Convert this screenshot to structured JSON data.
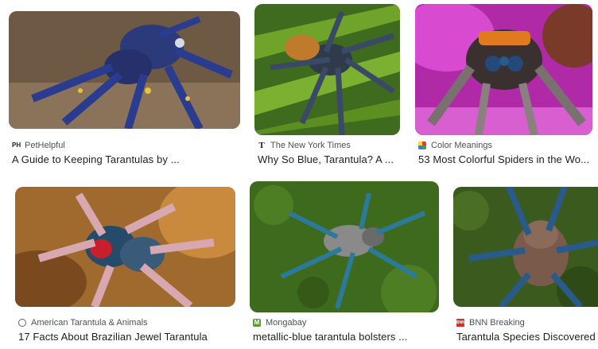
{
  "results": [
    {
      "source": "PetHelpful",
      "favicon": "PH",
      "title": "A Guide to Keeping Tarantulas by ..."
    },
    {
      "source": "The New York Times",
      "favicon": "T",
      "title": "Why So Blue, Tarantula? A ..."
    },
    {
      "source": "Color Meanings",
      "favicon": "palette-icon",
      "title": "53 Most Colorful Spiders in the Wo..."
    },
    {
      "source": "American Tarantula & Animals",
      "favicon": "globe-icon",
      "title": "17 Facts About Brazilian Jewel Tarantula"
    },
    {
      "source": "Mongabay",
      "favicon": "M",
      "title": "metallic-blue tarantula bolsters ..."
    },
    {
      "source": "BNN Breaking",
      "favicon": "BNN",
      "title": "Tarantula Species Discovered"
    }
  ],
  "colors": {
    "link_title": "#202124",
    "source_text": "#4d5156",
    "mongabay_green": "#5a9e2f",
    "bnn_red": "#d93025"
  }
}
